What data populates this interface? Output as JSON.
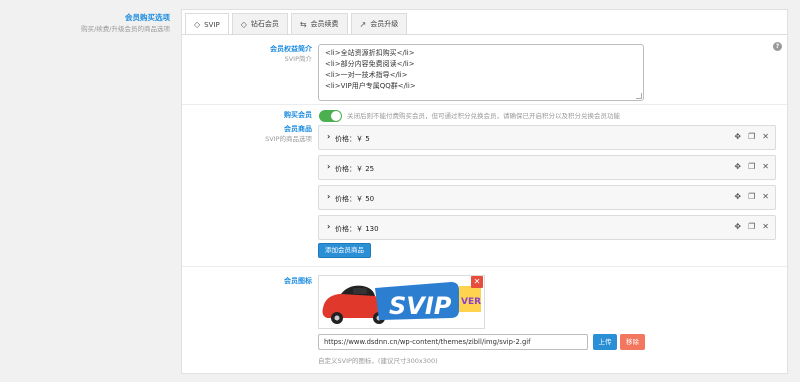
{
  "section": {
    "title": "会员购买选项",
    "subtitle": "购买/续费/升级会员的商品选项"
  },
  "tabs": [
    {
      "label": "SVIP",
      "icon": "gem-icon",
      "glyph": "◇",
      "active": true
    },
    {
      "label": "钻石会员",
      "icon": "gem-icon",
      "glyph": "◇",
      "active": false
    },
    {
      "label": "会员续费",
      "icon": "renew-icon",
      "glyph": "⇆",
      "active": false
    },
    {
      "label": "会员升级",
      "icon": "chart-line-icon",
      "glyph": "↗",
      "active": false
    }
  ],
  "benefits": {
    "label": "会员权益简介",
    "sublabel": "SVIP简介",
    "lines": [
      "<li>全站资源折扣购买</li>",
      "<li>部分内容免费阅读</li>",
      "<li>一对一技术指导</li>",
      "<li>VIP用户专属QQ群</li>"
    ]
  },
  "purchase": {
    "label": "购买会员",
    "enabled": true,
    "description": "关闭后则不能付费购买会员，但可通过积分兑换会员，请确保已开启积分以及积分兑换会员功能"
  },
  "products": {
    "label": "会员商品",
    "sublabel": "SVIP的商品选项",
    "items": [
      {
        "label": "价格：￥ 5"
      },
      {
        "label": "价格：￥ 25"
      },
      {
        "label": "价格：￥ 50"
      },
      {
        "label": "价格：￥ 130"
      }
    ],
    "add_button": "添加会员商品"
  },
  "icon_field": {
    "label": "会员图标",
    "image_text": "SVIP",
    "image_badge": "VER",
    "url": "https://www.dsdnn.cn/wp-content/themes/zibll/img/svip-2.gif",
    "upload_button": "上传",
    "remove_button": "移除",
    "hint": "自定义SVIP的图标，(建议尺寸300x300)"
  },
  "colors": {
    "accent": "#1b8be0",
    "toggle_on": "#4caf50",
    "remove": "#f2775e"
  }
}
